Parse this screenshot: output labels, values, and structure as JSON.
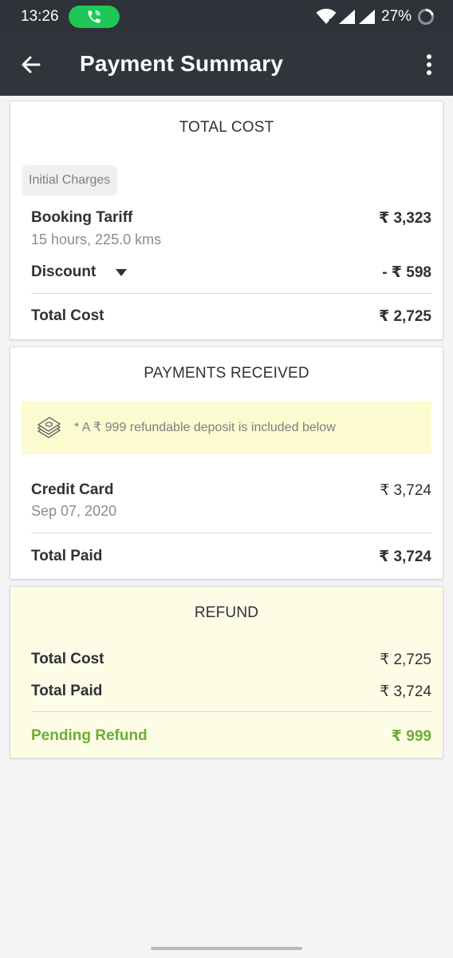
{
  "status_bar": {
    "time": "13:26",
    "battery": "27%"
  },
  "app_bar": {
    "title": "Payment Summary"
  },
  "total_cost_card": {
    "title": "TOTAL COST",
    "chip": "Initial Charges",
    "booking_tariff_label": "Booking Tariff",
    "booking_tariff_detail": "15 hours, 225.0 kms",
    "booking_tariff_value": "₹ 3,323",
    "discount_label": "Discount",
    "discount_value": "- ₹ 598",
    "total_label": "Total Cost",
    "total_value": "₹ 2,725"
  },
  "payments_card": {
    "title": "PAYMENTS RECEIVED",
    "note": "* A ₹ 999 refundable deposit is included below",
    "method_label": "Credit Card",
    "method_date": "Sep 07, 2020",
    "method_value": "₹ 3,724",
    "total_label": "Total Paid",
    "total_value": "₹ 3,724"
  },
  "refund_card": {
    "title": "REFUND",
    "total_cost_label": "Total Cost",
    "total_cost_value": "₹ 2,725",
    "total_paid_label": "Total Paid",
    "total_paid_value": "₹ 3,724",
    "pending_label": "Pending Refund",
    "pending_value": "₹ 999"
  },
  "colors": {
    "app_bar": "#30353c",
    "status_bar": "#2f3339",
    "call_pill": "#1ec756",
    "note_background": "#fbfbcf",
    "refund_background": "#fdfde6",
    "refund_green": "#6cae35"
  },
  "icons": [
    "phone-call-icon",
    "wifi-icon",
    "signal-icon",
    "battery-icon",
    "back-arrow-icon",
    "more-vert-icon",
    "dropdown-caret-icon",
    "cash-stack-icon"
  ]
}
